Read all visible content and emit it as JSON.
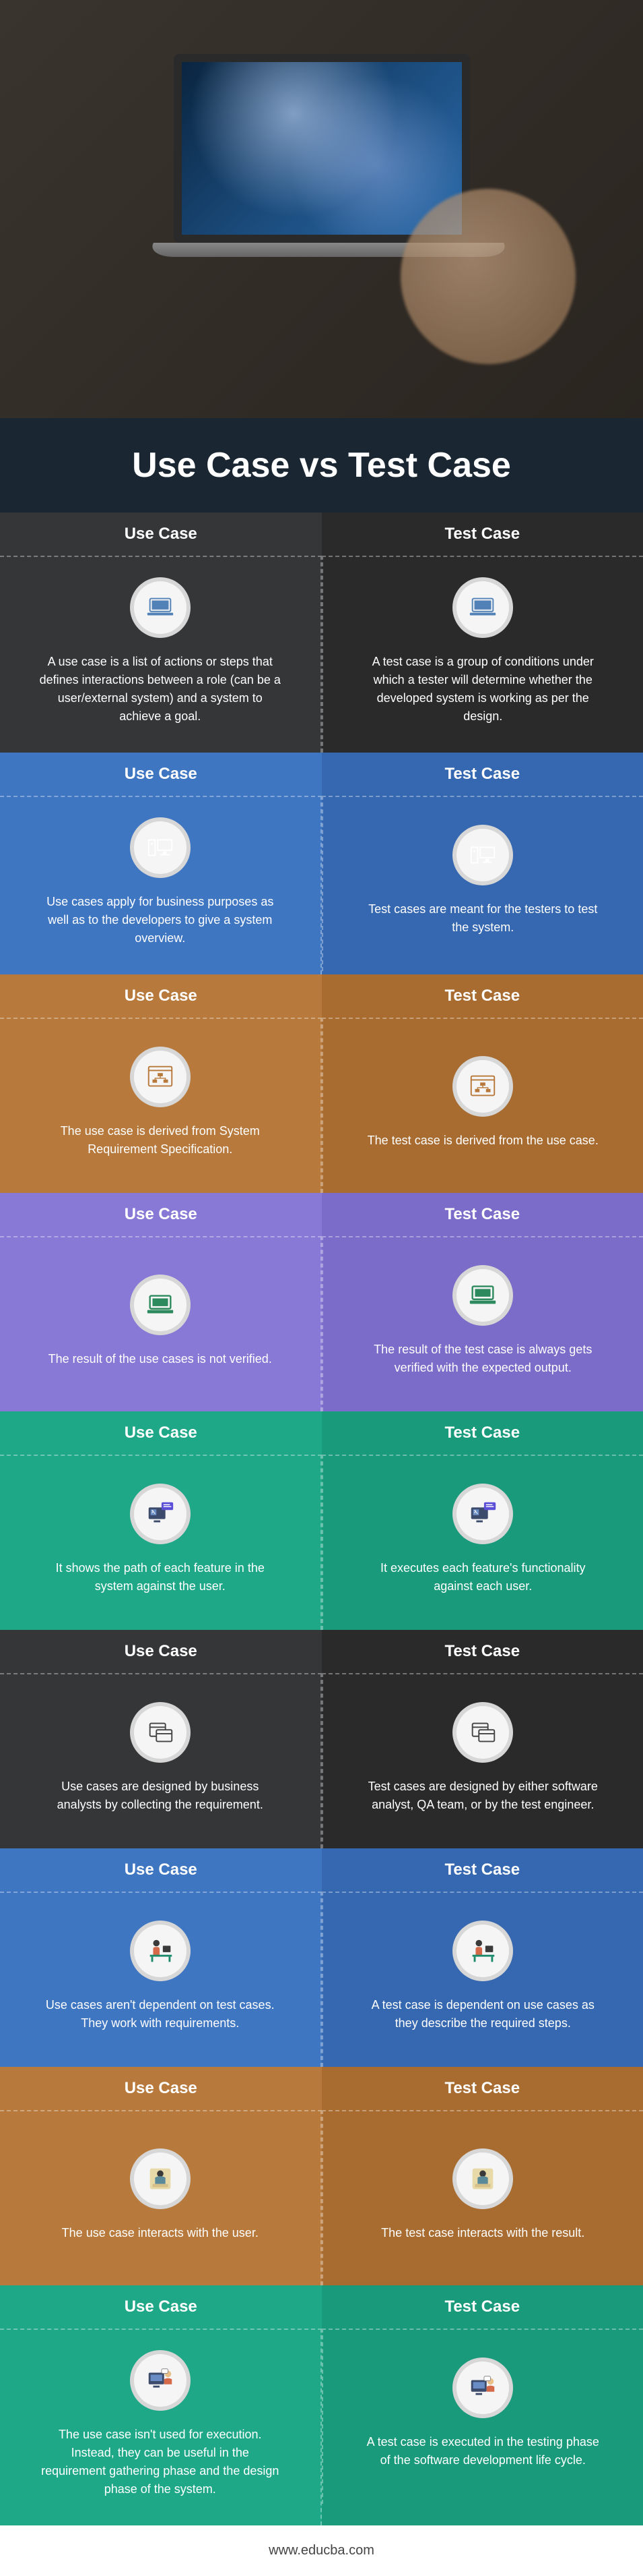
{
  "title": "Use Case vs Test Case",
  "labels": {
    "use": "Use Case",
    "test": "Test Case"
  },
  "rows": [
    {
      "use": "A use case is a list of actions or steps that defines interactions between a role (can be a user/external system) and a system to achieve a goal.",
      "test": "A test case is a group of conditions under which a tester will determine whether the developed system is working as per the design.",
      "icon": "laptop"
    },
    {
      "use": "Use cases apply for business purposes as well as to the developers to give a system overview.",
      "test": "Test cases are meant for the testers to test the system.",
      "icon": "monitor-tower"
    },
    {
      "use": "The use case is derived from System Requirement Specification.",
      "test": "The test case is derived from the use case.",
      "icon": "window-tree"
    },
    {
      "use": "The result of the use cases is not verified.",
      "test": "The result of the test case is always gets verified with the expected output.",
      "icon": "laptop-green"
    },
    {
      "use": "It shows the path of each feature in the system against the user.",
      "test": "It executes each feature's functionality against each user.",
      "icon": "desktop-bubble"
    },
    {
      "use": "Use cases are designed by business analysts by collecting the requirement.",
      "test": "Test cases are designed by either software analyst, QA team, or by the test engineer.",
      "icon": "window-stack"
    },
    {
      "use": "Use cases aren't dependent on test cases. They work with requirements.",
      "test": "A test case is dependent on use cases as they describe the required steps.",
      "icon": "person-desk"
    },
    {
      "use": "The use case interacts with the user.",
      "test": "The test case interacts with the result.",
      "icon": "person-top"
    },
    {
      "use": "The use case isn't used for execution. Instead, they can be useful in the requirement gathering phase and the design phase of the system.",
      "test": "A test case is executed in the testing phase of the software development life cycle.",
      "icon": "person-monitor"
    }
  ],
  "footer": "www.educba.com"
}
